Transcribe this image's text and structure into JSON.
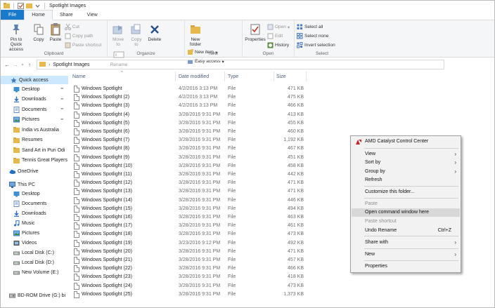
{
  "window": {
    "title": "Spotlight Images"
  },
  "tabs": [
    "File",
    "Home",
    "Share",
    "View"
  ],
  "ribbon": {
    "clipboard": {
      "label": "Clipboard",
      "pin": "Pin to Quick access",
      "copy": "Copy",
      "paste": "Paste",
      "cut": "Cut",
      "copy_path": "Copy path",
      "paste_shortcut": "Paste shortcut"
    },
    "organize": {
      "label": "Organize",
      "move_to": "Move to",
      "copy_to": "Copy to",
      "delete": "Delete",
      "rename": "Rename"
    },
    "new": {
      "label": "New",
      "new_folder": "New folder",
      "new_item": "New item",
      "easy_access": "Easy access"
    },
    "open": {
      "label": "Open",
      "properties": "Properties",
      "open": "Open",
      "edit": "Edit",
      "history": "History"
    },
    "select": {
      "label": "Select",
      "select_all": "Select all",
      "select_none": "Select none",
      "invert": "Invert selection"
    }
  },
  "address": {
    "path": "Spotlight Images"
  },
  "nav": {
    "quick_access": "Quick access",
    "items": [
      {
        "label": "Desktop",
        "icon": "desktop-icon",
        "pinned": true
      },
      {
        "label": "Downloads",
        "icon": "download-icon",
        "pinned": true
      },
      {
        "label": "Documents",
        "icon": "documents-icon",
        "pinned": true
      },
      {
        "label": "Pictures",
        "icon": "pictures-icon",
        "pinned": true
      },
      {
        "label": "India vs Australia",
        "icon": "folder-icon",
        "pinned": false
      },
      {
        "label": "Resumes",
        "icon": "folder-icon",
        "pinned": false
      },
      {
        "label": "Sand Art in Puri Odi",
        "icon": "folder-icon",
        "pinned": false
      },
      {
        "label": "Tennis Great Players",
        "icon": "folder-icon",
        "pinned": false
      }
    ],
    "onedrive": "OneDrive",
    "this_pc": "This PC",
    "pc_items": [
      {
        "label": "Desktop",
        "icon": "desktop-icon"
      },
      {
        "label": "Documents",
        "icon": "documents-icon"
      },
      {
        "label": "Downloads",
        "icon": "download-icon"
      },
      {
        "label": "Music",
        "icon": "music-icon"
      },
      {
        "label": "Pictures",
        "icon": "pictures-icon"
      },
      {
        "label": "Videos",
        "icon": "videos-icon"
      },
      {
        "label": "Local Disk (C:)",
        "icon": "disk-icon"
      },
      {
        "label": "Local Disk (D:)",
        "icon": "disk-icon"
      },
      {
        "label": "New Volume (E:)",
        "icon": "disk-icon"
      },
      {
        "label": "BD-ROM Drive (G:)",
        "icon": "disc-drive-icon"
      }
    ],
    "bd_rom": "BD-ROM Drive (G:) bi"
  },
  "columns": {
    "name": "Name",
    "date": "Date modified",
    "type": "Type",
    "size": "Size"
  },
  "files": [
    {
      "name": "Windows Spotlight",
      "date": "4/2/2016 3:13 PM",
      "type": "File",
      "size": "471 KB"
    },
    {
      "name": "Windows Spotlight (2)",
      "date": "4/2/2016 3:13 PM",
      "type": "File",
      "size": "475 KB"
    },
    {
      "name": "Windows Spotlight (3)",
      "date": "4/2/2016 3:13 PM",
      "type": "File",
      "size": "466 KB"
    },
    {
      "name": "Windows Spotlight (4)",
      "date": "3/28/2016 9:31 PM",
      "type": "File",
      "size": "413 KB"
    },
    {
      "name": "Windows Spotlight (5)",
      "date": "3/28/2016 9:31 PM",
      "type": "File",
      "size": "455 KB"
    },
    {
      "name": "Windows Spotlight (6)",
      "date": "3/28/2016 9:31 PM",
      "type": "File",
      "size": "460 KB"
    },
    {
      "name": "Windows Spotlight (7)",
      "date": "3/28/2016 9:31 PM",
      "type": "File",
      "size": "1,192 KB"
    },
    {
      "name": "Windows Spotlight (8)",
      "date": "3/28/2016 9:31 PM",
      "type": "File",
      "size": "467 KB"
    },
    {
      "name": "Windows Spotlight (9)",
      "date": "3/28/2016 9:31 PM",
      "type": "File",
      "size": "451 KB"
    },
    {
      "name": "Windows Spotlight (10)",
      "date": "3/28/2016 9:31 PM",
      "type": "File",
      "size": "458 KB"
    },
    {
      "name": "Windows Spotlight (11)",
      "date": "3/28/2016 9:31 PM",
      "type": "File",
      "size": "442 KB"
    },
    {
      "name": "Windows Spotlight (12)",
      "date": "3/28/2016 9:31 PM",
      "type": "File",
      "size": "471 KB"
    },
    {
      "name": "Windows Spotlight (13)",
      "date": "3/28/2016 9:31 PM",
      "type": "File",
      "size": "471 KB"
    },
    {
      "name": "Windows Spotlight (14)",
      "date": "3/28/2016 9:31 PM",
      "type": "File",
      "size": "446 KB"
    },
    {
      "name": "Windows Spotlight (15)",
      "date": "3/28/2016 9:31 PM",
      "type": "File",
      "size": "494 KB"
    },
    {
      "name": "Windows Spotlight (16)",
      "date": "3/28/2016 9:31 PM",
      "type": "File",
      "size": "463 KB"
    },
    {
      "name": "Windows Spotlight (17)",
      "date": "3/28/2016 9:31 PM",
      "type": "File",
      "size": "461 KB"
    },
    {
      "name": "Windows Spotlight (18)",
      "date": "3/28/2016 9:31 PM",
      "type": "File",
      "size": "473 KB"
    },
    {
      "name": "Windows Spotlight (19)",
      "date": "3/23/2016 9:12 PM",
      "type": "File",
      "size": "492 KB"
    },
    {
      "name": "Windows Spotlight (20)",
      "date": "3/28/2016 9:31 PM",
      "type": "File",
      "size": "471 KB"
    },
    {
      "name": "Windows Spotlight (21)",
      "date": "3/28/2016 9:31 PM",
      "type": "File",
      "size": "457 KB"
    },
    {
      "name": "Windows Spotlight (22)",
      "date": "3/28/2016 9:31 PM",
      "type": "File",
      "size": "466 KB"
    },
    {
      "name": "Windows Spotlight (23)",
      "date": "3/28/2016 9:31 PM",
      "type": "File",
      "size": "418 KB"
    },
    {
      "name": "Windows Spotlight (24)",
      "date": "3/28/2016 9:31 PM",
      "type": "File",
      "size": "473 KB"
    },
    {
      "name": "Windows Spotlight (25)",
      "date": "3/28/2016 9:31 PM",
      "type": "File",
      "size": "1,373 KB"
    }
  ],
  "context_menu": {
    "amd": "AMD Catalyst Control Center",
    "view": "View",
    "sort_by": "Sort by",
    "group_by": "Group by",
    "refresh": "Refresh",
    "customize": "Customize this folder...",
    "paste": "Paste",
    "open_cmd": "Open command window here",
    "paste_shortcut": "Paste shortcut",
    "undo_rename": "Undo Rename",
    "undo_shortcut": "Ctrl+Z",
    "share_with": "Share with",
    "new": "New",
    "properties": "Properties"
  },
  "colors": {
    "file_tab": "#1979ca",
    "selection": "#cce8ff",
    "accent": "#1979ca",
    "folder": "#e8b94a"
  }
}
